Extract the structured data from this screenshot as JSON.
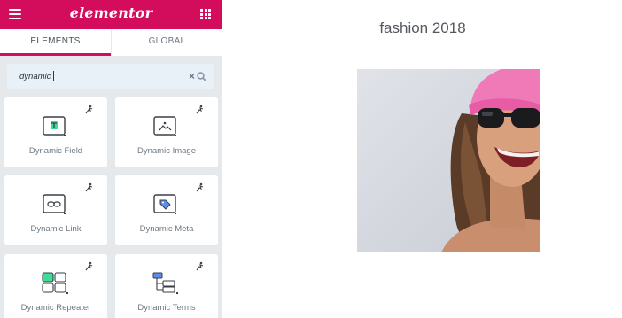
{
  "editor": {
    "brand": "elementor",
    "tabs": [
      {
        "label": "ELEMENTS",
        "active": true
      },
      {
        "label": "GLOBAL",
        "active": false
      }
    ],
    "search": {
      "value": "dynamic"
    },
    "widgets": [
      {
        "label": "Dynamic Field",
        "icon": "dynamic-field-icon"
      },
      {
        "label": "Dynamic Image",
        "icon": "dynamic-image-icon"
      },
      {
        "label": "Dynamic Link",
        "icon": "dynamic-link-icon"
      },
      {
        "label": "Dynamic Meta",
        "icon": "dynamic-meta-icon"
      },
      {
        "label": "Dynamic Repeater",
        "icon": "dynamic-repeater-icon"
      },
      {
        "label": "Dynamic Terms",
        "icon": "dynamic-terms-icon"
      }
    ],
    "colors": {
      "brand": "#d30c5c",
      "accent_green": "#3ddc97",
      "accent_blue": "#5b8def"
    }
  },
  "preview": {
    "heading": "fashion 2018"
  }
}
